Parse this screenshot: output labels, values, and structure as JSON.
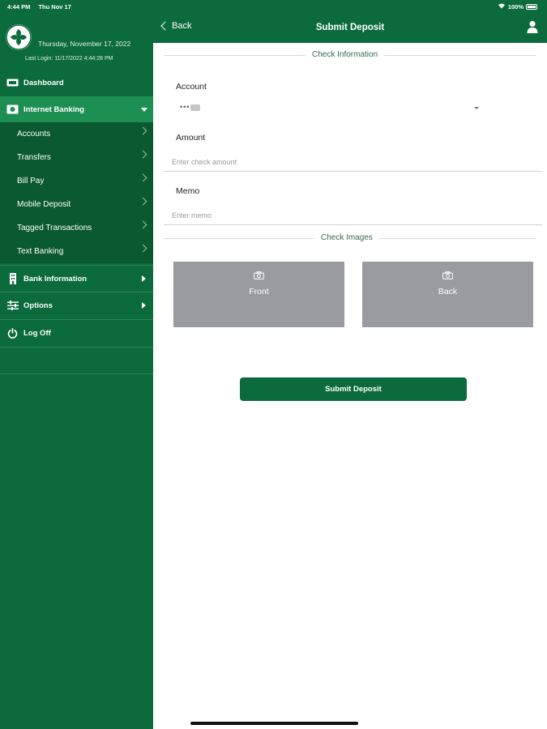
{
  "status_bar": {
    "time": "4:44 PM",
    "date": "Thu Nov 17",
    "battery": "100%"
  },
  "sidebar": {
    "profile": {
      "date": "Thursday, November 17, 2022",
      "last_login": "Last Login: 11/17/2022 4:44:28 PM"
    },
    "dashboard": {
      "label": "Dashboard",
      "icon": "dashboard-icon"
    },
    "internet_banking": {
      "label": "Internet Banking",
      "icon": "internet-banking-icon",
      "expanded": true,
      "items": [
        {
          "label": "Accounts"
        },
        {
          "label": "Transfers"
        },
        {
          "label": "Bill Pay"
        },
        {
          "label": "Mobile Deposit"
        },
        {
          "label": "Tagged Transactions"
        },
        {
          "label": "Text Banking"
        }
      ]
    },
    "bank_information": {
      "label": "Bank Information",
      "icon": "bank-building-icon"
    },
    "options": {
      "label": "Options",
      "icon": "sliders-icon"
    },
    "log_off": {
      "label": "Log Off",
      "icon": "power-icon"
    }
  },
  "header": {
    "back_label": "Back",
    "title": "Submit Deposit"
  },
  "form": {
    "check_information_label": "Check Information",
    "account": {
      "label": "Account",
      "value": "•••"
    },
    "amount": {
      "label": "Amount",
      "placeholder": "Enter check amount"
    },
    "memo": {
      "label": "Memo",
      "placeholder": "Enter memo"
    },
    "check_images_label": "Check Images",
    "front_label": "Front",
    "back_label": "Back",
    "submit_label": "Submit Deposit"
  },
  "colors": {
    "primary_green": "#0c6b3d",
    "highlight_green": "#1e8f52",
    "submenu_green": "#0a5931",
    "check_placeholder_gray": "#9a9ba1"
  }
}
